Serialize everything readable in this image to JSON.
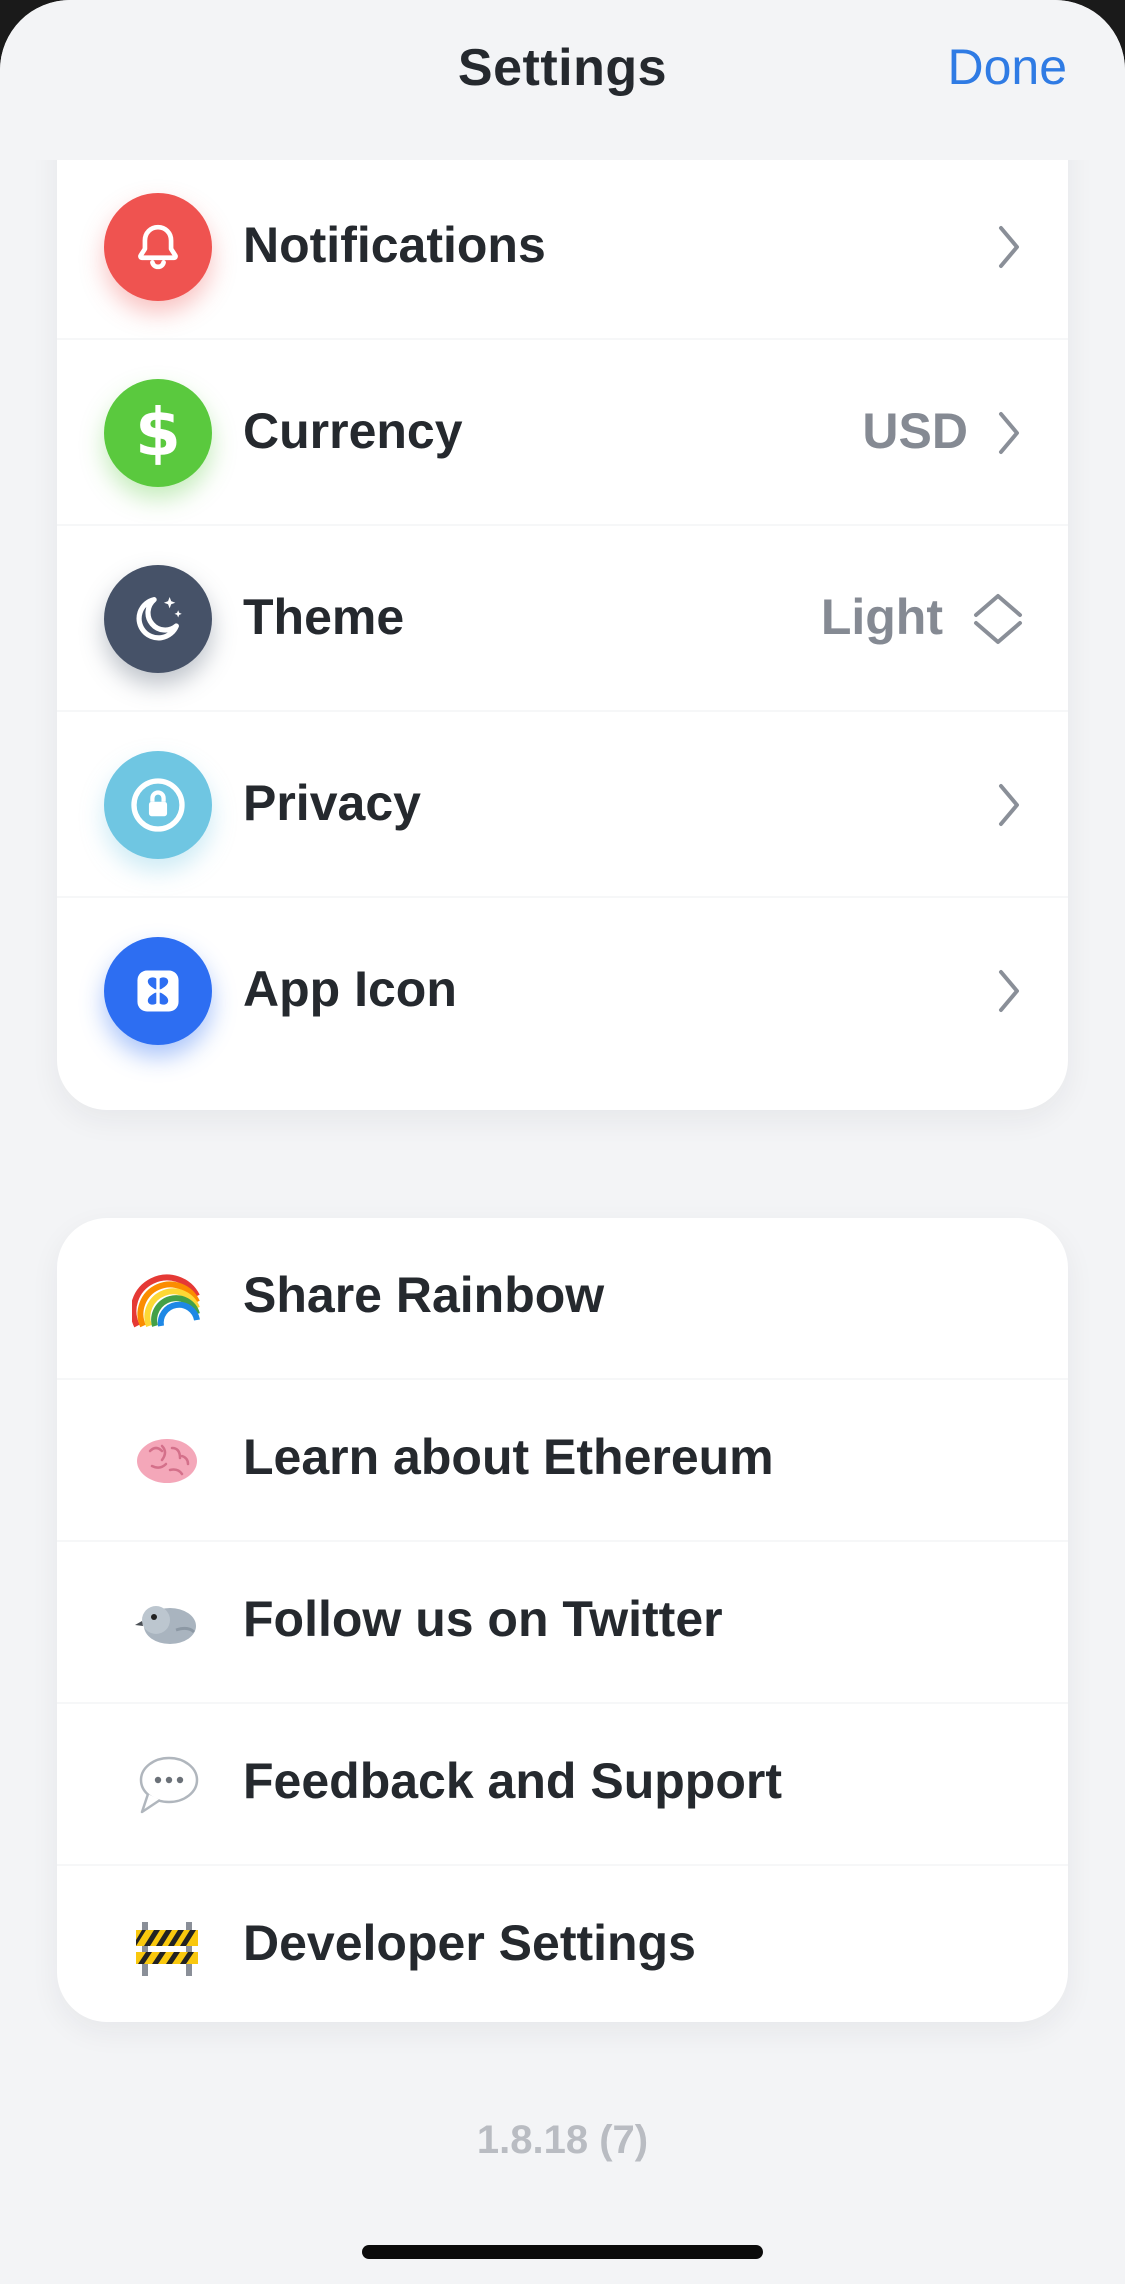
{
  "header": {
    "title": "Settings",
    "done_label": "Done"
  },
  "settings_items": [
    {
      "label": "Notifications",
      "value": "",
      "icon": "bell-icon",
      "color": "#ef5350",
      "accessory": "chevron"
    },
    {
      "label": "Currency",
      "value": "USD",
      "icon": "dollar-icon",
      "color": "#5ac93e",
      "accessory": "chevron"
    },
    {
      "label": "Theme",
      "value": "Light",
      "icon": "moon-icon",
      "color": "#465268",
      "accessory": "up-down"
    },
    {
      "label": "Privacy",
      "value": "",
      "icon": "lock-icon",
      "color": "#6fc6e2",
      "accessory": "chevron"
    },
    {
      "label": "App Icon",
      "value": "",
      "icon": "app-icon-icon",
      "color": "#2d6ef2",
      "accessory": "chevron"
    }
  ],
  "link_items": [
    {
      "label": "Share Rainbow",
      "icon": "rainbow-icon"
    },
    {
      "label": "Learn about Ethereum",
      "icon": "brain-icon"
    },
    {
      "label": "Follow us on Twitter",
      "icon": "bird-icon"
    },
    {
      "label": "Feedback and Support",
      "icon": "speech-bubble-icon"
    },
    {
      "label": "Developer Settings",
      "icon": "construction-barrier-icon"
    }
  ],
  "version": "1.8.18 (7)"
}
